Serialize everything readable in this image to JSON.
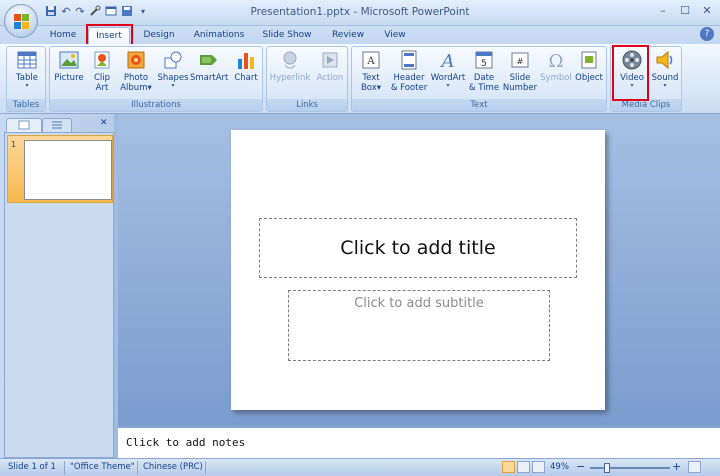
{
  "window": {
    "title": "Presentation1.pptx - Microsoft PowerPoint",
    "minimize": "–",
    "maximize": "☐",
    "close": "✕",
    "help": "?"
  },
  "quick_access": {
    "undo": "↶",
    "redo": "↷"
  },
  "tabs": [
    "Home",
    "Insert",
    "Design",
    "Animations",
    "Slide Show",
    "Review",
    "View"
  ],
  "ribbon": {
    "groups": [
      "Tables",
      "Illustrations",
      "Links",
      "Text",
      "Media Clips"
    ],
    "tables": {
      "table": "Table"
    },
    "illustrations": {
      "picture": "Picture",
      "clip_line1": "Clip",
      "clip_line2": "Art",
      "photo_line1": "Photo",
      "photo_line2": "Album",
      "shapes": "Shapes",
      "smartart": "SmartArt",
      "chart": "Chart"
    },
    "links": {
      "hyperlink": "Hyperlink",
      "action": "Action"
    },
    "text": {
      "textbox_line1": "Text",
      "textbox_line2": "Box",
      "header_line1": "Header",
      "header_line2": "& Footer",
      "wordart": "WordArt",
      "date_line1": "Date",
      "date_line2": "& Time",
      "slidenum_line1": "Slide",
      "slidenum_line2": "Number",
      "symbol": "Symbol",
      "object": "Object"
    },
    "media": {
      "video": "Video",
      "sound": "Sound"
    }
  },
  "thumb": {
    "number": "1"
  },
  "slide": {
    "title_placeholder": "Click to add title",
    "subtitle_placeholder": "Click to add subtitle"
  },
  "notes": {
    "placeholder": "Click to add notes"
  },
  "status": {
    "slide": "Slide 1 of 1",
    "theme": "\"Office Theme\"",
    "language": "Chinese (PRC)",
    "zoom": "49%",
    "zoom_out": "−",
    "zoom_in": "+"
  },
  "colors": {
    "highlight": "#e1001a",
    "ribbon_text": "#15428b"
  }
}
